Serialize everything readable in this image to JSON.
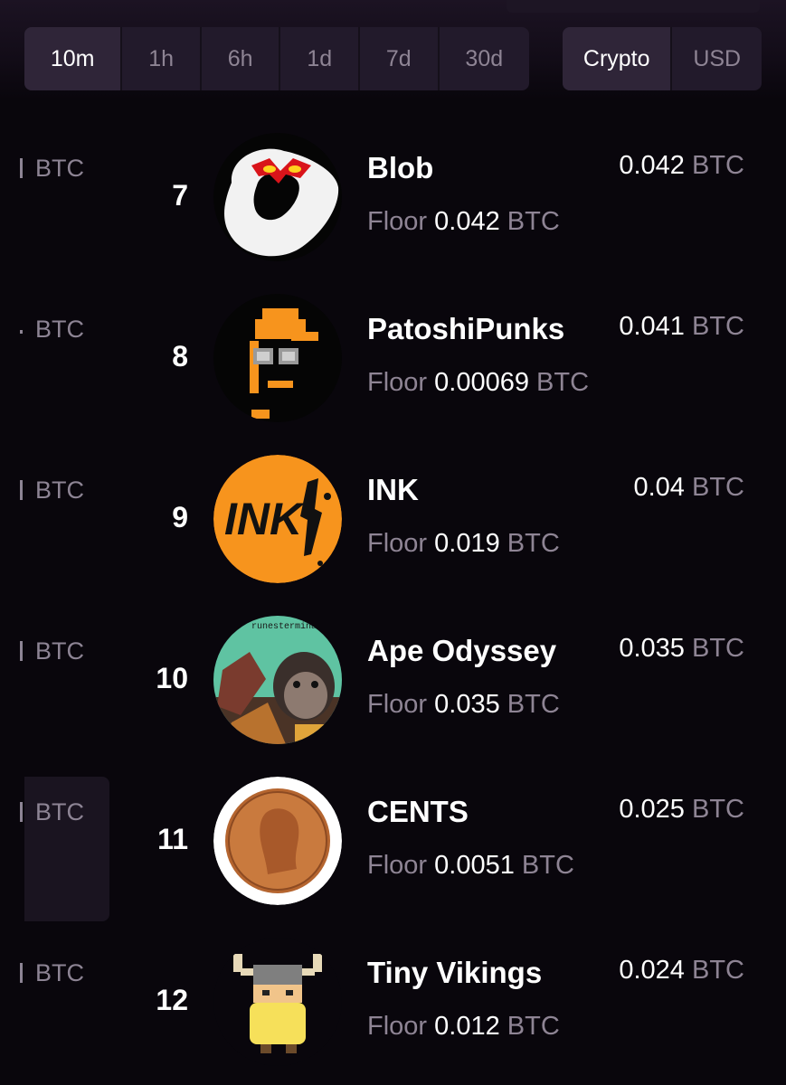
{
  "filters": {
    "time_options": [
      {
        "label": "10m",
        "active": true
      },
      {
        "label": "1h",
        "active": false
      },
      {
        "label": "6h",
        "active": false
      },
      {
        "label": "1d",
        "active": false
      },
      {
        "label": "7d",
        "active": false
      },
      {
        "label": "30d",
        "active": false
      }
    ],
    "currency_options": [
      {
        "label": "Crypto",
        "active": true
      },
      {
        "label": "USD",
        "active": false
      }
    ]
  },
  "rows": [
    {
      "rank": "7",
      "name": "Blob",
      "price": "0.042",
      "price_unit": "BTC",
      "floor_label": "Floor",
      "floor_value": "0.042",
      "floor_unit": "BTC",
      "left_partial": "BTC",
      "avatar": "blob-avatar"
    },
    {
      "rank": "8",
      "name": "PatoshiPunks",
      "price": "0.041",
      "price_unit": "BTC",
      "floor_label": "Floor",
      "floor_value": "0.00069",
      "floor_unit": "BTC",
      "left_partial": "BTC",
      "avatar": "patoshipunks-avatar"
    },
    {
      "rank": "9",
      "name": "INK",
      "price": "0.04",
      "price_unit": "BTC",
      "floor_label": "Floor",
      "floor_value": "0.019",
      "floor_unit": "BTC",
      "left_partial": "BTC",
      "avatar": "ink-avatar"
    },
    {
      "rank": "10",
      "name": "Ape Odyssey",
      "price": "0.035",
      "price_unit": "BTC",
      "floor_label": "Floor",
      "floor_value": "0.035",
      "floor_unit": "BTC",
      "left_partial": "BTC",
      "avatar": "ape-odyssey-avatar",
      "avatar_caption": "runesterminal"
    },
    {
      "rank": "11",
      "name": "CENTS",
      "price": "0.025",
      "price_unit": "BTC",
      "floor_label": "Floor",
      "floor_value": "0.0051",
      "floor_unit": "BTC",
      "left_partial": "BTC",
      "avatar": "cents-avatar"
    },
    {
      "rank": "12",
      "name": "Tiny Vikings",
      "price": "0.024",
      "price_unit": "BTC",
      "floor_label": "Floor",
      "floor_value": "0.012",
      "floor_unit": "BTC",
      "left_partial": "BTC",
      "avatar": "tiny-vikings-avatar"
    }
  ],
  "colors": {
    "background": "#09060c",
    "segment_bg": "#221a2b",
    "segment_active": "#2f2538",
    "muted_text": "#8e8494",
    "ink_orange": "#f7941d"
  }
}
